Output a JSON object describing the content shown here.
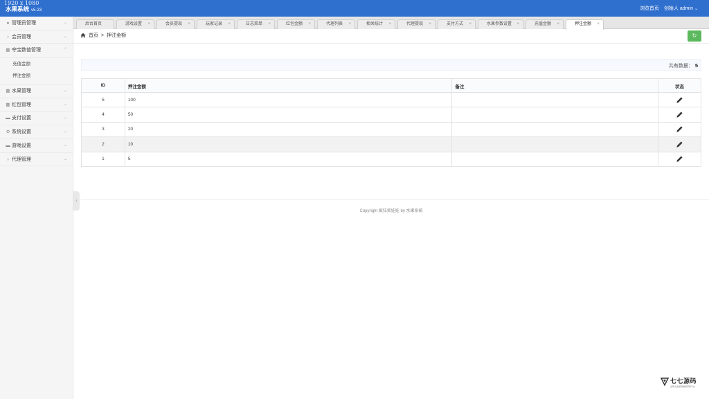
{
  "header": {
    "resolution": "1920 x 1080",
    "app_title": "水果系统",
    "version": "v5-23",
    "browse_home": "浏览首页",
    "role": "创始人",
    "user": "admin"
  },
  "sidebar": {
    "items": [
      {
        "label": "管理员管理",
        "icon": "user-icon"
      },
      {
        "label": "会员管理",
        "icon": "person-icon"
      },
      {
        "label": "夺宝数值管理",
        "icon": "building-icon",
        "expanded": true,
        "children": [
          "充值金额",
          "押注金额"
        ]
      },
      {
        "label": "水果管理",
        "icon": "building-icon"
      },
      {
        "label": "红包管理",
        "icon": "building-icon"
      },
      {
        "label": "支付设置",
        "icon": "card-icon"
      },
      {
        "label": "系统设置",
        "icon": "gear-icon"
      },
      {
        "label": "游戏设置",
        "icon": "card-icon"
      },
      {
        "label": "代理管理",
        "icon": "person-icon"
      }
    ]
  },
  "tabs": [
    "后台首页",
    "游戏设置",
    "会员提现",
    "玩家记录",
    "日志菜单",
    "红包金额",
    "代理列表",
    "相关统计",
    "代理提现",
    "支付方式",
    "水果参数设置",
    "充值金额",
    "押注金额"
  ],
  "active_tab": "押注金额",
  "breadcrumb": {
    "home": "首页",
    "separator": ">",
    "current": "押注金额"
  },
  "info": {
    "count_label": "共有数据：",
    "count": "5"
  },
  "table": {
    "headers": {
      "id": "ID",
      "amount": "押注金额",
      "note": "备注",
      "status": "状态"
    },
    "rows": [
      {
        "id": "5",
        "amount": "100",
        "note": ""
      },
      {
        "id": "4",
        "amount": "50",
        "note": ""
      },
      {
        "id": "3",
        "amount": "20",
        "note": ""
      },
      {
        "id": "2",
        "amount": "10",
        "note": ""
      },
      {
        "id": "1",
        "amount": "5",
        "note": ""
      }
    ]
  },
  "footer": {
    "copyright": "Copyright 疯狂抓娃娃 by 水果系统"
  },
  "watermark": {
    "name": "七七源码",
    "sub": "全网大型游戏棋牌源码平台"
  },
  "colors": {
    "header": "#2f6fce",
    "refresh": "#5cb85c"
  }
}
